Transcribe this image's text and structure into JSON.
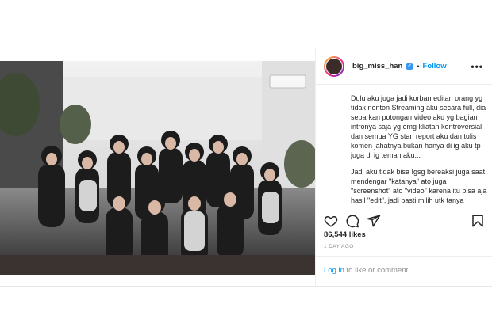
{
  "post": {
    "username": "big_miss_han",
    "verified": true,
    "separator": "•",
    "follow_label": "Follow",
    "more_label": "•••",
    "caption_paragraphs": [
      "Dulu aku juga jadi korban editan orang yg tidak nonton Streaming aku secara full, dia sebarkan potongan video aku yg bagian intronya saja yg emg kliatan kontroversial dan semua YG stan report aku dan tulis komen jahatnya bukan hanya di ig aku tp juga di ig teman aku...",
      "Jadi aku tidak bisa Igsg bereaksi juga saat mendengar \"katanya\" ato juga \"screenshot\" ato \"video\" karena itu bisa aja hasil \"edit\", jadi pasti milih utk tanya"
    ],
    "likes": "86,544 likes",
    "time": "1 DAY AGO",
    "login_link": "Log in",
    "login_rest": " to like or comment.",
    "icons": {
      "like": "heart-icon",
      "comment": "comment-icon",
      "share": "share-icon",
      "save": "bookmark-icon"
    },
    "colors": {
      "link_blue": "#0095f6",
      "verified_blue": "#3897f0",
      "text": "#262626",
      "muted": "#8e8e8e"
    }
  }
}
